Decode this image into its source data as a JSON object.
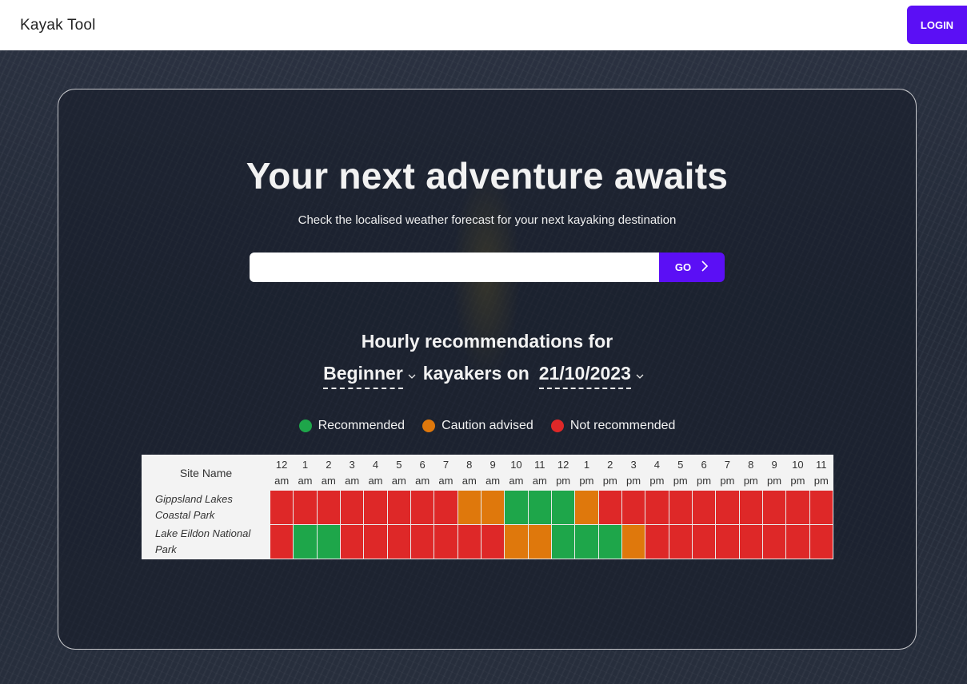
{
  "app": {
    "brand": "Kayak Tool",
    "login_label": "LOGIN"
  },
  "hero": {
    "headline": "Your next adventure awaits",
    "subline": "Check the localised weather forecast for your next kayaking destination",
    "search": {
      "value": "",
      "placeholder": ""
    },
    "go_label": "GO"
  },
  "recommendations": {
    "title": "Hourly recommendations for",
    "skill_level": "Beginner",
    "middle_text": "kayakers on",
    "date": "21/10/2023"
  },
  "legend": [
    {
      "label": "Recommended",
      "color": "#1ea64a"
    },
    {
      "label": "Caution advised",
      "color": "#df780c"
    },
    {
      "label": "Not recommended",
      "color": "#de2828"
    }
  ],
  "table": {
    "site_header": "Site Name",
    "hours": [
      {
        "h": "12",
        "p": "am"
      },
      {
        "h": "1",
        "p": "am"
      },
      {
        "h": "2",
        "p": "am"
      },
      {
        "h": "3",
        "p": "am"
      },
      {
        "h": "4",
        "p": "am"
      },
      {
        "h": "5",
        "p": "am"
      },
      {
        "h": "6",
        "p": "am"
      },
      {
        "h": "7",
        "p": "am"
      },
      {
        "h": "8",
        "p": "am"
      },
      {
        "h": "9",
        "p": "am"
      },
      {
        "h": "10",
        "p": "am"
      },
      {
        "h": "11",
        "p": "am"
      },
      {
        "h": "12",
        "p": "pm"
      },
      {
        "h": "1",
        "p": "pm"
      },
      {
        "h": "2",
        "p": "pm"
      },
      {
        "h": "3",
        "p": "pm"
      },
      {
        "h": "4",
        "p": "pm"
      },
      {
        "h": "5",
        "p": "pm"
      },
      {
        "h": "6",
        "p": "pm"
      },
      {
        "h": "7",
        "p": "pm"
      },
      {
        "h": "8",
        "p": "pm"
      },
      {
        "h": "9",
        "p": "pm"
      },
      {
        "h": "10",
        "p": "pm"
      },
      {
        "h": "11",
        "p": "pm"
      }
    ],
    "rows": [
      {
        "site": "Gippsland Lakes Coastal Park",
        "status": [
          "red",
          "red",
          "red",
          "red",
          "red",
          "red",
          "red",
          "red",
          "orange",
          "orange",
          "green",
          "green",
          "green",
          "orange",
          "red",
          "red",
          "red",
          "red",
          "red",
          "red",
          "red",
          "red",
          "red",
          "red"
        ]
      },
      {
        "site": "Lake Eildon National Park",
        "status": [
          "red",
          "green",
          "green",
          "red",
          "red",
          "red",
          "red",
          "red",
          "red",
          "red",
          "orange",
          "orange",
          "green",
          "green",
          "green",
          "orange",
          "red",
          "red",
          "red",
          "red",
          "red",
          "red",
          "red",
          "red"
        ]
      }
    ]
  }
}
